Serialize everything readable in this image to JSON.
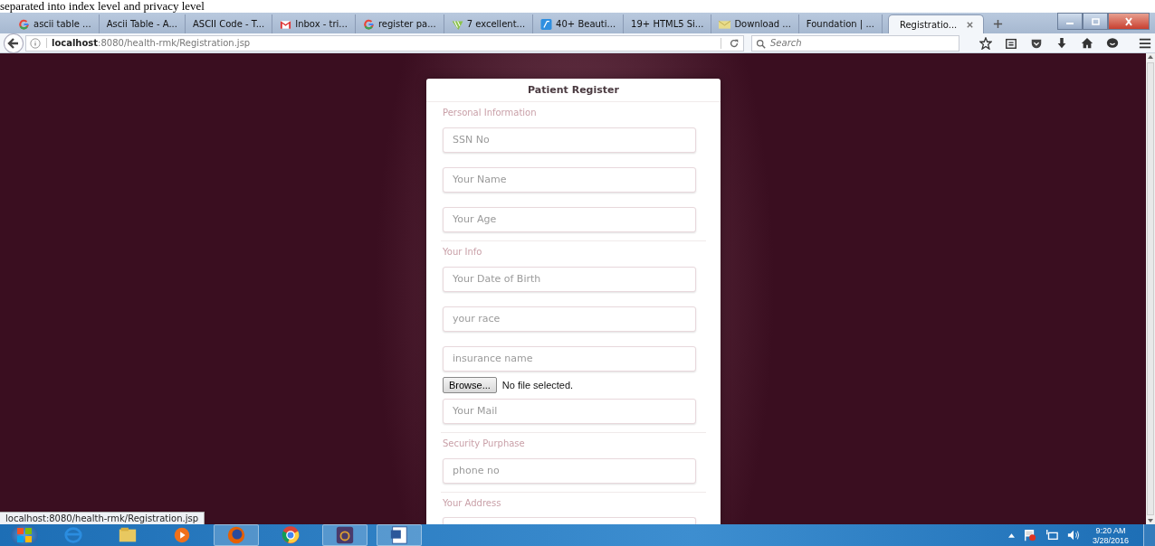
{
  "document_caption": "separated into index level and privacy level",
  "tabs": [
    {
      "label": "ascii table ...",
      "selected": false
    },
    {
      "label": "Ascii Table - A...",
      "selected": false
    },
    {
      "label": "ASCII Code - T...",
      "selected": false
    },
    {
      "label": "Inbox - tri...",
      "selected": false
    },
    {
      "label": "register pa...",
      "selected": false
    },
    {
      "label": "7 excellent...",
      "selected": false
    },
    {
      "label": "40+ Beauti...",
      "selected": false
    },
    {
      "label": "19+ HTML5 Si...",
      "selected": false
    },
    {
      "label": "Download ...",
      "selected": false
    },
    {
      "label": "Foundation | ...",
      "selected": false
    },
    {
      "label": "Registratio...",
      "selected": true
    }
  ],
  "address": {
    "host": "localhost",
    "rest": ":8080/health-rmk/Registration.jsp"
  },
  "search": {
    "placeholder": "Search"
  },
  "form": {
    "title": "Patient Register",
    "sections": [
      {
        "label": "Personal Information",
        "fields": [
          {
            "kind": "text",
            "placeholder": "SSN No"
          },
          {
            "kind": "text",
            "placeholder": "Your Name"
          },
          {
            "kind": "text",
            "placeholder": "Your Age"
          }
        ]
      },
      {
        "label": "Your Info",
        "fields": [
          {
            "kind": "text",
            "placeholder": "Your Date of Birth"
          },
          {
            "kind": "text",
            "placeholder": "your race"
          },
          {
            "kind": "text",
            "placeholder": "insurance name"
          },
          {
            "kind": "file",
            "button": "Browse...",
            "status": "No file selected."
          },
          {
            "kind": "text",
            "placeholder": "Your Mail"
          }
        ]
      },
      {
        "label": "Security Purphase",
        "fields": [
          {
            "kind": "text",
            "placeholder": "phone no"
          }
        ]
      },
      {
        "label": "Your Address"
      }
    ]
  },
  "status_url": "localhost:8080/health-rmk/Registration.jsp",
  "taskbar": {
    "time": "9:20 AM",
    "date": "3/28/2016"
  }
}
